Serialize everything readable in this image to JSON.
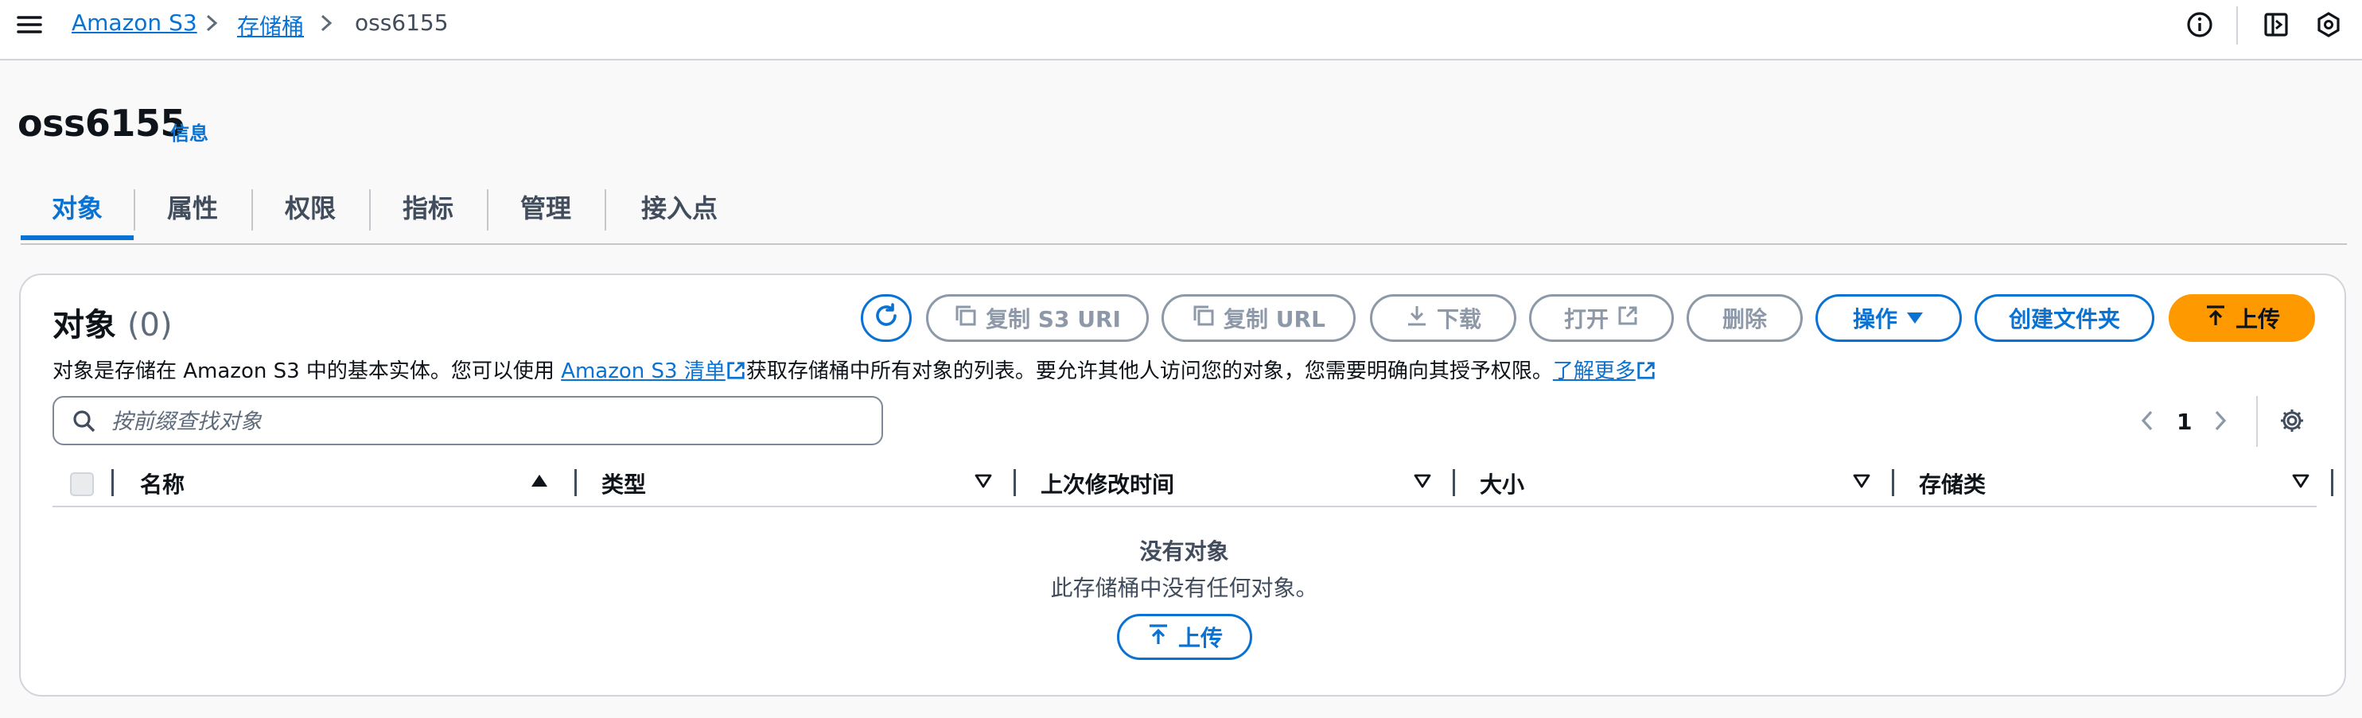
{
  "breadcrumb": {
    "items": [
      "Amazon S3",
      "存储桶"
    ],
    "current": "oss6155"
  },
  "header": {
    "title": "oss6155",
    "info_label": "信息"
  },
  "tabs": [
    {
      "label": "对象",
      "active": true
    },
    {
      "label": "属性"
    },
    {
      "label": "权限"
    },
    {
      "label": "指标"
    },
    {
      "label": "管理"
    },
    {
      "label": "接入点"
    }
  ],
  "objects_panel": {
    "title": "对象",
    "count": "(0)",
    "buttons": {
      "copy_s3_uri": "复制 S3 URI",
      "copy_url": "复制 URL",
      "download": "下载",
      "open": "打开",
      "delete": "删除",
      "actions": "操作",
      "create_folder": "创建文件夹",
      "upload": "上传"
    },
    "description": {
      "part1": "对象是存储在 Amazon S3 中的基本实体。您可以使用 ",
      "link1": "Amazon S3 清单",
      "part2": "获取存储桶中所有对象的列表。要允许其他人访问您的对象，您需要明确向其授予权限。",
      "link2": "了解更多"
    },
    "search_placeholder": "按前缀查找对象",
    "pagination": {
      "page": "1"
    },
    "columns": [
      "名称",
      "类型",
      "上次修改时间",
      "大小",
      "存储类"
    ],
    "empty_state": {
      "title": "没有对象",
      "description": "此存储桶中没有任何对象。",
      "upload_label": "上传"
    }
  },
  "colors": {
    "accent": "#0972d3",
    "upload": "#ff9900",
    "disabled": "#8d99a8"
  }
}
